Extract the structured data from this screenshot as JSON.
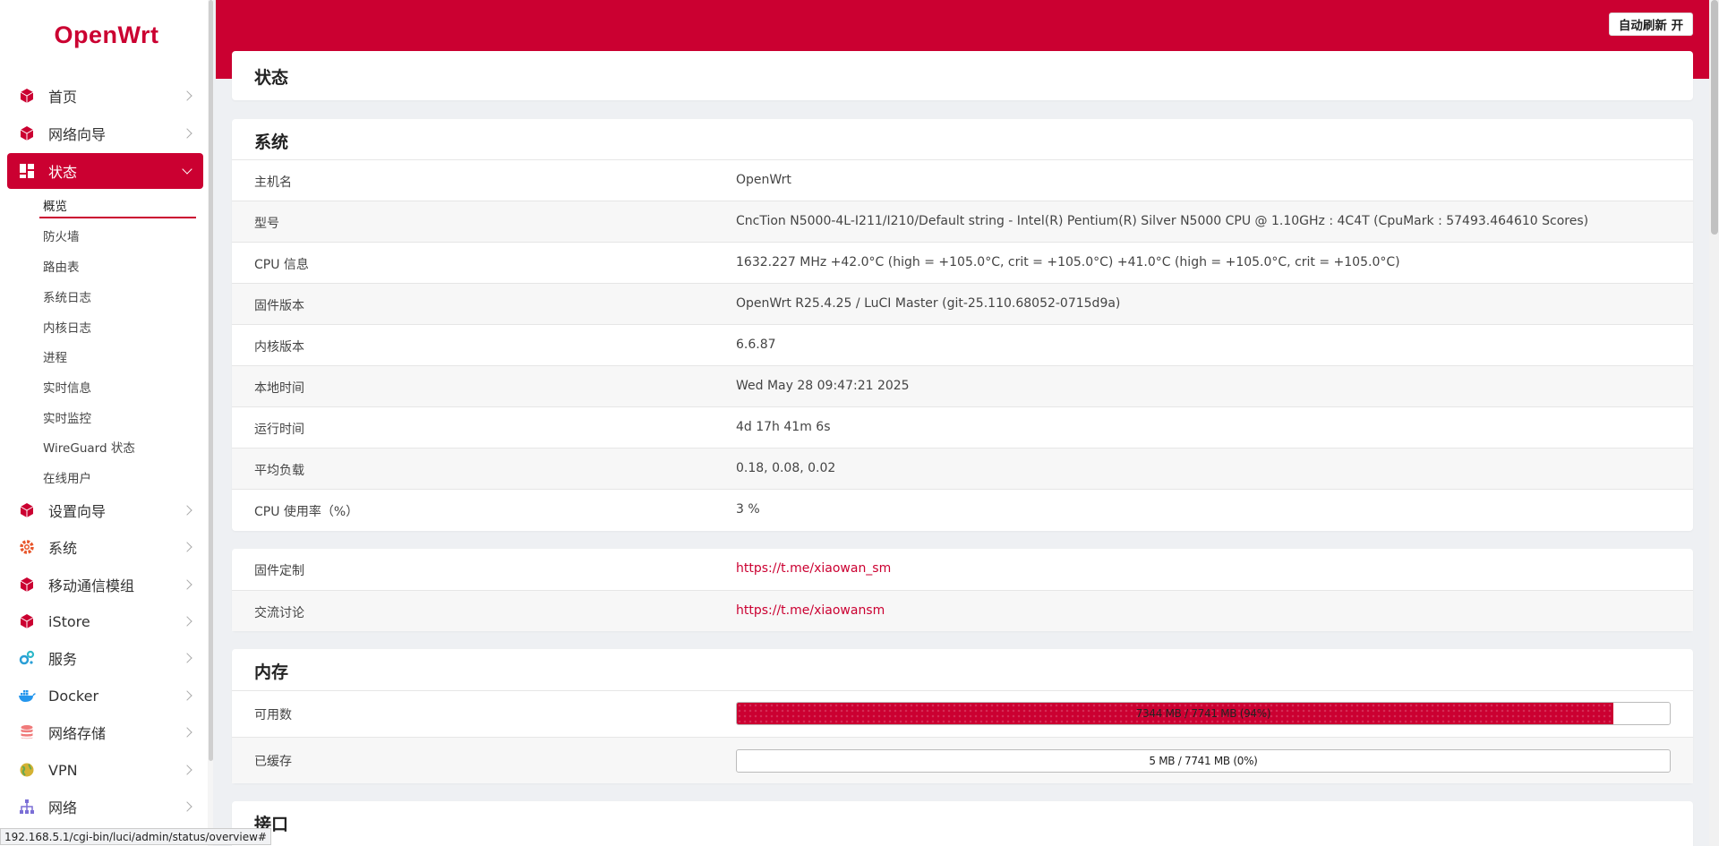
{
  "brand": {
    "logo": "OpenWrt",
    "accent_color": "#cb0031"
  },
  "topbar": {
    "refresh_button": "自动刷新 开"
  },
  "sidebar": {
    "items": [
      {
        "label": "首页",
        "icon": "cube-icon"
      },
      {
        "label": "网络向导",
        "icon": "cube-icon"
      },
      {
        "label": "状态",
        "icon": "dashboard-icon",
        "expanded": true
      },
      {
        "label": "设置向导",
        "icon": "cube-icon"
      },
      {
        "label": "系统",
        "icon": "gear-icon"
      },
      {
        "label": "移动通信模组",
        "icon": "cube-icon"
      },
      {
        "label": "iStore",
        "icon": "cube-icon"
      },
      {
        "label": "服务",
        "icon": "services-icon"
      },
      {
        "label": "Docker",
        "icon": "docker-icon"
      },
      {
        "label": "网络存储",
        "icon": "database-icon"
      },
      {
        "label": "VPN",
        "icon": "globe-icon"
      },
      {
        "label": "网络",
        "icon": "network-icon"
      }
    ],
    "status_subitems": [
      "概览",
      "防火墙",
      "路由表",
      "系统日志",
      "内核日志",
      "进程",
      "实时信息",
      "实时监控",
      "WireGuard 状态",
      "在线用户"
    ]
  },
  "page": {
    "title": "状态"
  },
  "system": {
    "title": "系统",
    "rows": [
      {
        "key": "主机名",
        "value": "OpenWrt"
      },
      {
        "key": "型号",
        "value": "CncTion N5000-4L-I211/I210/Default string - Intel(R) Pentium(R) Silver N5000 CPU @ 1.10GHz : 4C4T (CpuMark : 57493.464610 Scores)"
      },
      {
        "key": "CPU 信息",
        "value": "1632.227 MHz +42.0°C (high = +105.0°C, crit = +105.0°C) +41.0°C (high = +105.0°C, crit = +105.0°C)"
      },
      {
        "key": "固件版本",
        "value": "OpenWrt R25.4.25 / LuCI Master (git-25.110.68052-0715d9a)"
      },
      {
        "key": "内核版本",
        "value": "6.6.87"
      },
      {
        "key": "本地时间",
        "value": "Wed May 28 09:47:21 2025"
      },
      {
        "key": "运行时间",
        "value": "4d 17h 41m 6s"
      },
      {
        "key": "平均负载",
        "value": "0.18, 0.08, 0.02"
      },
      {
        "key": "CPU 使用率（%）",
        "value": "3 %"
      }
    ]
  },
  "links": {
    "rows": [
      {
        "key": "固件定制",
        "value": "https://t.me/xiaowan_sm"
      },
      {
        "key": "交流讨论",
        "value": "https://t.me/xiaowansm"
      }
    ]
  },
  "memory": {
    "title": "内存",
    "rows": [
      {
        "key": "可用数",
        "text": "7344 MB / 7741 MB (94%)",
        "fraction": 0.94
      },
      {
        "key": "已缓存",
        "text": "5 MB / 7741 MB (0%)",
        "fraction": 0.0
      }
    ]
  },
  "interfaces": {
    "title": "接口"
  },
  "statusbar": {
    "url": "192.168.5.1/cgi-bin/luci/admin/status/overview#"
  }
}
